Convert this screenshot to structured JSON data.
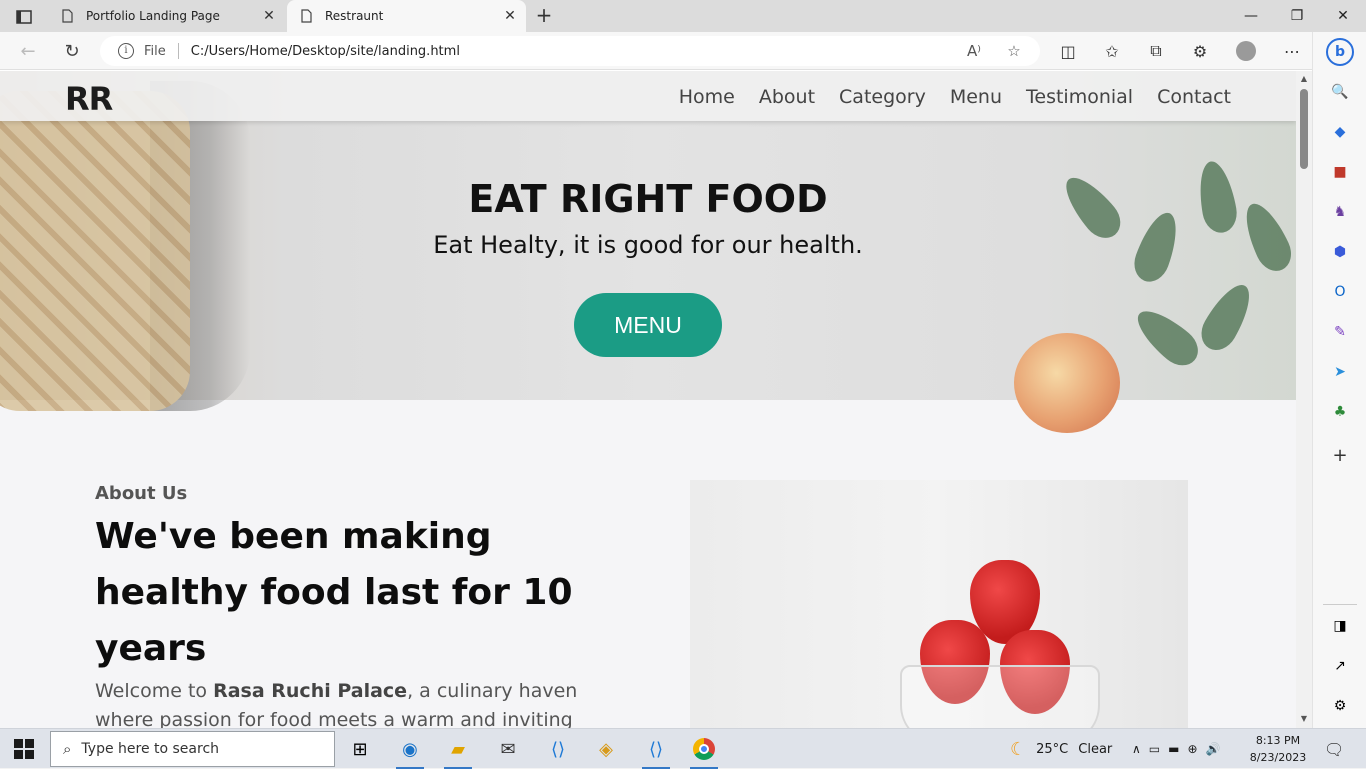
{
  "browser": {
    "tabs": [
      {
        "title": "Portfolio Landing Page",
        "active": false
      },
      {
        "title": "Restraunt",
        "active": true
      }
    ],
    "address": {
      "scheme_label": "File",
      "url": "C:/Users/Home/Desktop/site/landing.html"
    }
  },
  "page": {
    "logo": "RR",
    "nav": [
      "Home",
      "About",
      "Category",
      "Menu",
      "Testimonial",
      "Contact"
    ],
    "hero": {
      "title": "EAT RIGHT FOOD",
      "subtitle": "Eat Healty, it is good for our health.",
      "button": "MENU"
    },
    "about": {
      "eyebrow": "About Us",
      "heading": "We've been making healthy food last for 10 years",
      "text_prefix": "Welcome to ",
      "text_brand": "Rasa Ruchi Palace",
      "text_suffix": ", a culinary haven where passion for food meets a warm and inviting"
    },
    "accent_color": "#1b9c85"
  },
  "taskbar": {
    "search_placeholder": "Type here to search",
    "weather": {
      "temp": "25°C",
      "condition": "Clear"
    },
    "time": "8:13 PM",
    "date": "8/23/2023"
  }
}
